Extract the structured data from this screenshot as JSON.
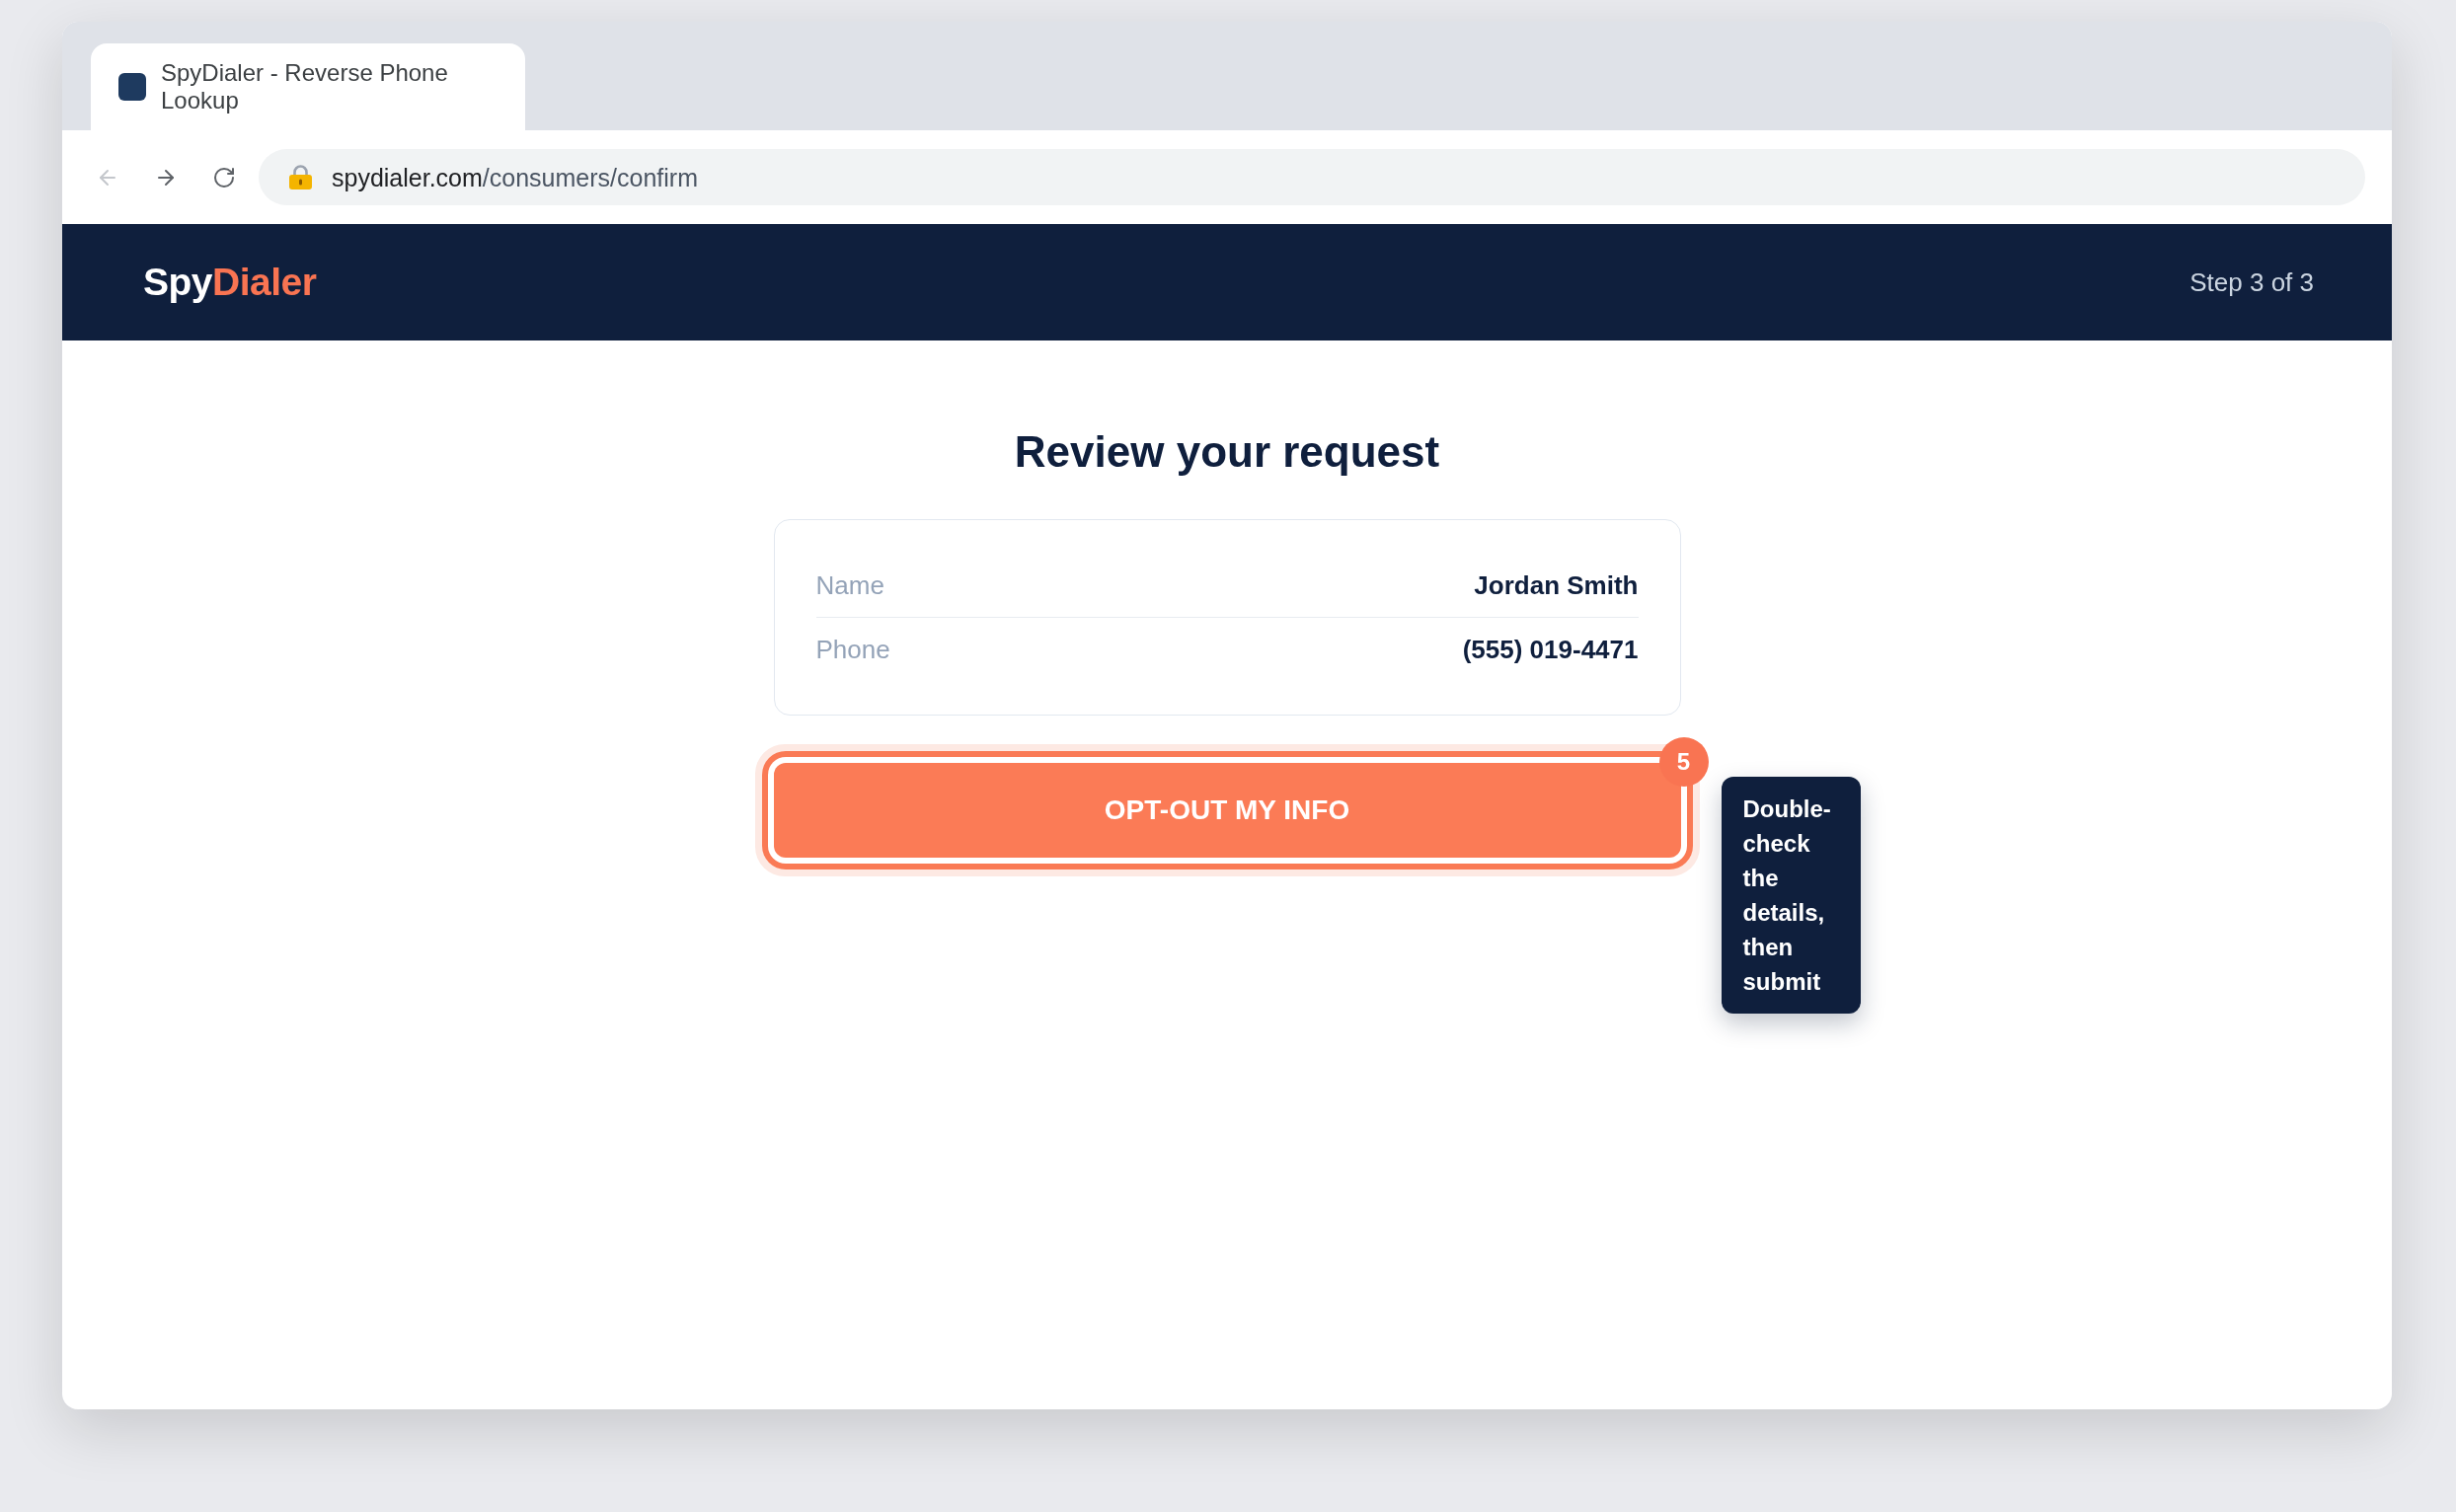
{
  "browser": {
    "tab": {
      "title": "SpyDialer - Reverse Phone Lookup",
      "selected": true
    },
    "nav": [
      {
        "kind": "back",
        "disabled": true
      },
      {
        "kind": "forward",
        "disabled": false
      },
      {
        "kind": "reload",
        "disabled": false
      }
    ],
    "url": {
      "host": "spydialer.com",
      "path": "/consumers/confirm"
    }
  },
  "header": {
    "logo": {
      "primary": "Spy",
      "accent": "Dialer"
    },
    "step": "Step 3 of 3"
  },
  "title": "Review your request",
  "details": [
    {
      "label": "Name",
      "value": "Jordan Smith"
    },
    {
      "label": "Phone",
      "value": "(555) 019-4471"
    }
  ],
  "submit_button": {
    "label": "OPT-OUT MY INFO",
    "focused": true,
    "badge": "5"
  },
  "tooltip": "Double-check the details, then submit"
}
